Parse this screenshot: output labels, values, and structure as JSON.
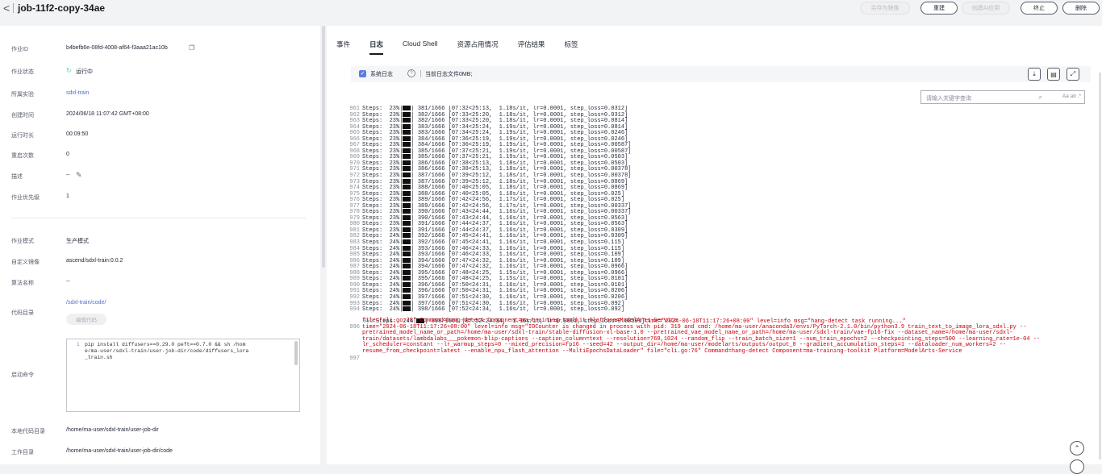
{
  "header": {
    "title": "job-11f2-copy-34ae",
    "buttons": {
      "save_image": "另存为镜像",
      "rebuild": "重建",
      "create_ai_app": "创建AI应用",
      "stop": "终止",
      "delete": "删除"
    }
  },
  "details": {
    "job_id_label": "作业ID",
    "job_id": "b4befb6e-08fd-4008-af64-f3aaa21ac10b",
    "status_label": "作业状态",
    "status": "运行中",
    "experiment_label": "所属实验",
    "experiment": "sdxl-train",
    "created_label": "创建时间",
    "created": "2024/06/18 11:07:42 GMT+08:00",
    "duration_label": "运行时长",
    "duration": "00:09:50",
    "restarts_label": "重启次数",
    "restarts": "0",
    "desc_label": "描述",
    "desc": "--",
    "priority_label": "作业优先级",
    "priority": "1",
    "mode_label": "作业模式",
    "mode": "生产模式",
    "image_label": "自定义镜像",
    "image": "ascend/sdxl-train:0.0.2",
    "algo_label": "算法名称",
    "algo": "--",
    "code_dir_label": "代码目录",
    "code_dir": "/sdxl-train/code/",
    "edit_code": "编辑代码",
    "cmd_label": "启动命令",
    "cmd_line_no": "1",
    "cmd": "pip install diffusers==0.29.0 peft==0.7.0 && sh /home/ma-user/sdxl-train/user-job-dir/code/diffusers_lora_train.sh",
    "local_dir_label": "本地代码目录",
    "local_dir": "/home/ma-user/sdxl-train/user-job-dir",
    "work_dir_label": "工作目录",
    "work_dir": "/home/ma-user/sdxl-train/user-job-dir/code"
  },
  "tabs": [
    "事件",
    "日志",
    "Cloud Shell",
    "资源占用情况",
    "评估结果",
    "标签"
  ],
  "log": {
    "system_log": "系统日志",
    "file_size": "当前日志文件0MB;",
    "search_placeholder": "请输入关键字查询",
    "search_opts": "Aa ab .*",
    "lines": [
      [
        "961",
        "Steps:  23%|",
        "| 381/1666 [07:32<25:13,  1.18s/it, lr=0.0001, step_loss=0.0312]"
      ],
      [
        "962",
        "Steps:  23%|",
        "| 382/1666 [07:33<25:20,  1.18s/it, lr=0.0001, step_loss=0.0312]"
      ],
      [
        "963",
        "Steps:  23%|",
        "| 382/1666 [07:33<25:20,  1.18s/it, lr=0.0001, step_loss=0.0814]"
      ],
      [
        "964",
        "Steps:  23%|",
        "| 383/1666 [07:34<25:24,  1.19s/it, lr=0.0001, step_loss=0.0814]"
      ],
      [
        "965",
        "Steps:  23%|",
        "| 383/1666 [07:34<25:24,  1.19s/it, lr=0.0001, step_loss=0.0246]"
      ],
      [
        "966",
        "Steps:  23%|",
        "| 384/1666 [07:36<25:19,  1.19s/it, lr=0.0001, step_loss=0.0246]"
      ],
      [
        "967",
        "Steps:  23%|",
        "| 384/1666 [07:36<25:19,  1.19s/it, lr=0.0001, step_loss=0.00587]"
      ],
      [
        "968",
        "Steps:  23%|",
        "| 385/1666 [07:37<25:21,  1.19s/it, lr=0.0001, step_loss=0.00587]"
      ],
      [
        "969",
        "Steps:  23%|",
        "| 385/1666 [07:37<25:21,  1.19s/it, lr=0.0001, step_loss=0.0503]"
      ],
      [
        "970",
        "Steps:  23%|",
        "| 386/1666 [07:38<25:13,  1.18s/it, lr=0.0001, step_loss=0.0503]"
      ],
      [
        "971",
        "Steps:  23%|",
        "| 386/1666 [07:38<25:13,  1.18s/it, lr=0.0001, step_loss=0.00378]"
      ],
      [
        "972",
        "Steps:  23%|",
        "| 387/1666 [07:39<25:12,  1.18s/it, lr=0.0001, step_loss=0.00378]"
      ],
      [
        "973",
        "Steps:  23%|",
        "| 387/1666 [07:39<25:12,  1.18s/it, lr=0.0001, step_loss=0.0869]"
      ],
      [
        "974",
        "Steps:  23%|",
        "| 388/1666 [07:40<25:05,  1.18s/it, lr=0.0001, step_loss=0.0869]"
      ],
      [
        "975",
        "Steps:  23%|",
        "| 388/1666 [07:40<25:05,  1.18s/it, lr=0.0001, step_loss=0.025]"
      ],
      [
        "976",
        "Steps:  23%|",
        "| 389/1666 [07:42<24:56,  1.17s/it, lr=0.0001, step_loss=0.025]"
      ],
      [
        "977",
        "Steps:  23%|",
        "| 389/1666 [07:42<24:56,  1.17s/it, lr=0.0001, step_loss=0.00337]"
      ],
      [
        "978",
        "Steps:  23%|",
        "| 390/1666 [07:43<24:44,  1.16s/it, lr=0.0001, step_loss=0.00337]"
      ],
      [
        "979",
        "Steps:  23%|",
        "| 390/1666 [07:43<24:44,  1.16s/it, lr=0.0001, step_loss=0.0563]"
      ],
      [
        "980",
        "Steps:  23%|",
        "| 391/1666 [07:44<24:37,  1.16s/it, lr=0.0001, step_loss=0.0563]"
      ],
      [
        "981",
        "Steps:  23%|",
        "| 391/1666 [07:44<24:37,  1.16s/it, lr=0.0001, step_loss=0.0309]"
      ],
      [
        "982",
        "Steps:  24%|",
        "| 392/1666 [07:45<24:41,  1.16s/it, lr=0.0001, step_loss=0.0309]"
      ],
      [
        "983",
        "Steps:  24%|",
        "| 392/1666 [07:45<24:41,  1.16s/it, lr=0.0001, step_loss=0.115]"
      ],
      [
        "984",
        "Steps:  24%|",
        "| 393/1666 [07:46<24:33,  1.16s/it, lr=0.0001, step_loss=0.115]"
      ],
      [
        "985",
        "Steps:  24%|",
        "| 393/1666 [07:46<24:33,  1.16s/it, lr=0.0001, step_loss=0.109]"
      ],
      [
        "986",
        "Steps:  24%|",
        "| 394/1666 [07:47<24:32,  1.16s/it, lr=0.0001, step_loss=0.109]"
      ],
      [
        "987",
        "Steps:  24%|",
        "| 394/1666 [07:47<24:32,  1.16s/it, lr=0.0001, step_loss=0.0966]"
      ],
      [
        "988",
        "Steps:  24%|",
        "| 395/1666 [07:48<24:25,  1.15s/it, lr=0.0001, step_loss=0.0966]"
      ],
      [
        "989",
        "Steps:  24%|",
        "| 395/1666 [07:48<24:25,  1.15s/it, lr=0.0001, step_loss=0.0101]"
      ],
      [
        "990",
        "Steps:  24%|",
        "| 396/1666 [07:50<24:31,  1.16s/it, lr=0.0001, step_loss=0.0101]"
      ],
      [
        "991",
        "Steps:  24%|",
        "| 396/1666 [07:50<24:31,  1.16s/it, lr=0.0001, step_loss=0.0206]"
      ],
      [
        "992",
        "Steps:  24%|",
        "| 397/1666 [07:51<24:30,  1.16s/it, lr=0.0001, step_loss=0.0206]"
      ],
      [
        "993",
        "Steps:  24%|",
        "| 397/1666 [07:51<24:30,  1.16s/it, lr=0.0001, step_loss=0.092]"
      ],
      [
        "994",
        "Steps:  24%|",
        "| 398/1666 [07:52<24:34,  1.16s/it, lr=0.0001, step_loss=0.092]"
      ]
    ],
    "line995_no": "995",
    "line995_a": "Steps:  24%|",
    "line995_b": "| 398/1666 [07:52<24:34,  1.16s/it, lr=0.0001, step_loss=0.00391]",
    "line995_c": "time=\"2024-06-18T11:17:26+08:00\" level=info msg=\"hang-detect task running...\"",
    "line995_d": "file=\"cli.go:73\" Command=hang-detect Component=ma-training-toolkit Platform=ModelArts-Service",
    "line996_no": "996",
    "line996": "time=\"2024-06-18T11:17:26+08:00\" level=info msg=\"IOCounter is changed in process with pid: 319 and cmd: /home/ma-user/anaconda3/envs/PyTorch-2.1.0/bin/python3.9 train_text_to_image_lora_sdxl.py --pretrained_model_name_or_path=/home/ma-user/sdxl-train/stable-diffusion-xl-base-1.0 --pretrained_vae_model_name_or_path=/home/ma-user/sdxl-train/vae-fp16-fix --dataset_name=/home/ma-user/sdxl-train/datasets/lambdalabs___pokemon-blip-captions --caption_column=text --resolution=768,1024 --random_flip --train_batch_size=1 --num_train_epochs=2 --checkpointing_steps=500 --learning_rate=1e-04 --lr_scheduler=constant --lr_warmup_steps=0 --mixed_precision=fp16 --seed=42 --output_dir=/home/ma-user/modelarts/outputs/output_0 --gradient_accumulation_steps=1 --dataloader_num_workers=2 --resume_from_checkpoint=latest --enable_npu_flash_attention --MultiEpochsDataLoader\" file=\"cli.go:76\" Command=hang-detect Component=ma-training-toolkit Platform=ModelArts-Service",
    "line997_no": "997"
  },
  "colors": {
    "accent": "#5e7ce0",
    "link": "#526ecc",
    "error": "#c7000b"
  }
}
